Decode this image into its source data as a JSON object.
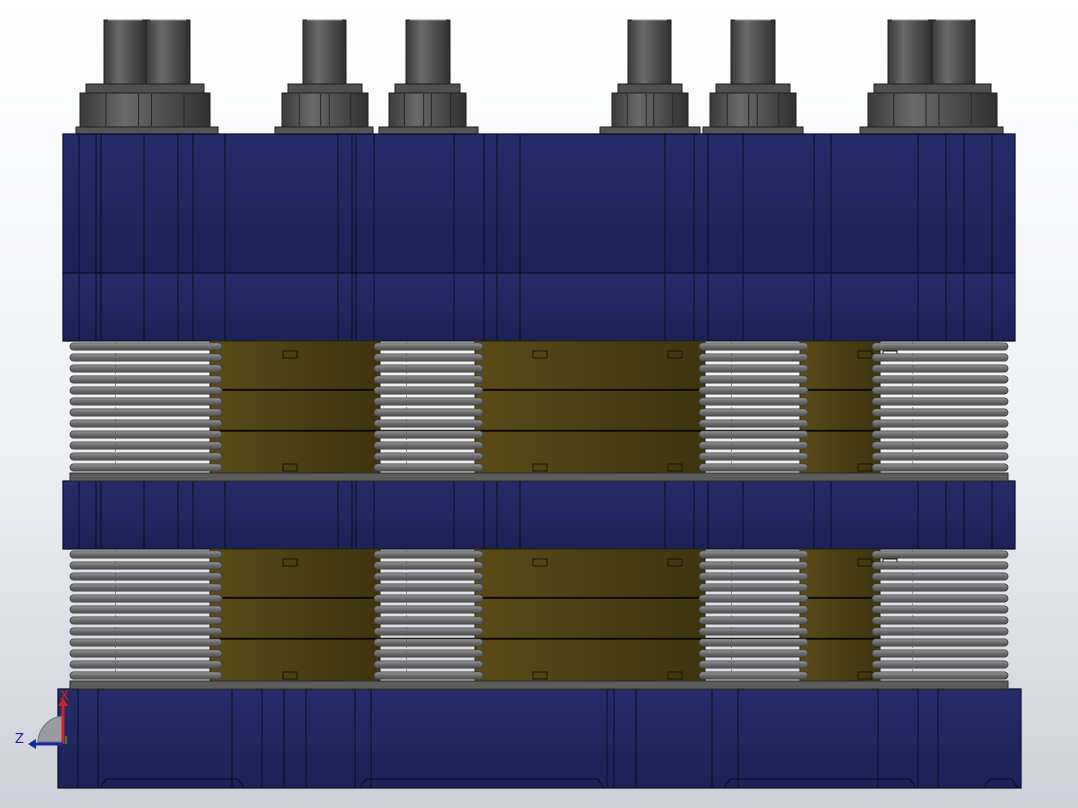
{
  "viewport": {
    "background_top": "#ffffff",
    "background_bottom": "#cdd0d8"
  },
  "model": {
    "plate_color": "#20265c",
    "plate_edge_color": "#0a0c22",
    "insert_color": "#4a4016",
    "spring_color": "#7a7a7a",
    "bolt_color": "#4a4a4a",
    "bolt_dark_color": "#2e2e2e",
    "washer_color": "#555555"
  },
  "triad": {
    "x_label": "X",
    "z_label": "Z",
    "x_color": "#d42020",
    "z_color": "#1a2a9a",
    "y_color": "#1e8c2a"
  }
}
